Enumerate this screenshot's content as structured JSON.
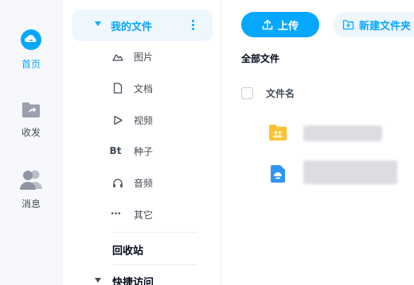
{
  "rail": {
    "items": [
      {
        "label": "首页",
        "icon": "cloud-home-icon",
        "active": true
      },
      {
        "label": "收发",
        "icon": "transfer-folder-icon",
        "active": false
      },
      {
        "label": "消息",
        "icon": "contacts-icon",
        "active": false
      }
    ]
  },
  "sidebar": {
    "my_files": "我的文件",
    "categories": [
      {
        "label": "图片",
        "icon": "image-icon"
      },
      {
        "label": "文档",
        "icon": "document-icon"
      },
      {
        "label": "视频",
        "icon": "video-icon"
      },
      {
        "label": "种子",
        "icon": "bt-icon",
        "glyph": "Bt"
      },
      {
        "label": "音频",
        "icon": "audio-icon"
      },
      {
        "label": "其它",
        "icon": "more-icon",
        "glyph": "•••"
      }
    ],
    "recycle_bin": "回收站",
    "quick_access": "快捷访问"
  },
  "toolbar": {
    "upload_label": "上传",
    "new_folder_label": "新建文件夹"
  },
  "main": {
    "breadcrumb": "全部文件",
    "column_name": "文件名"
  },
  "colors": {
    "accent": "#06a7ff",
    "accent_light": "#eef6fe",
    "folder": "#ffc032"
  }
}
